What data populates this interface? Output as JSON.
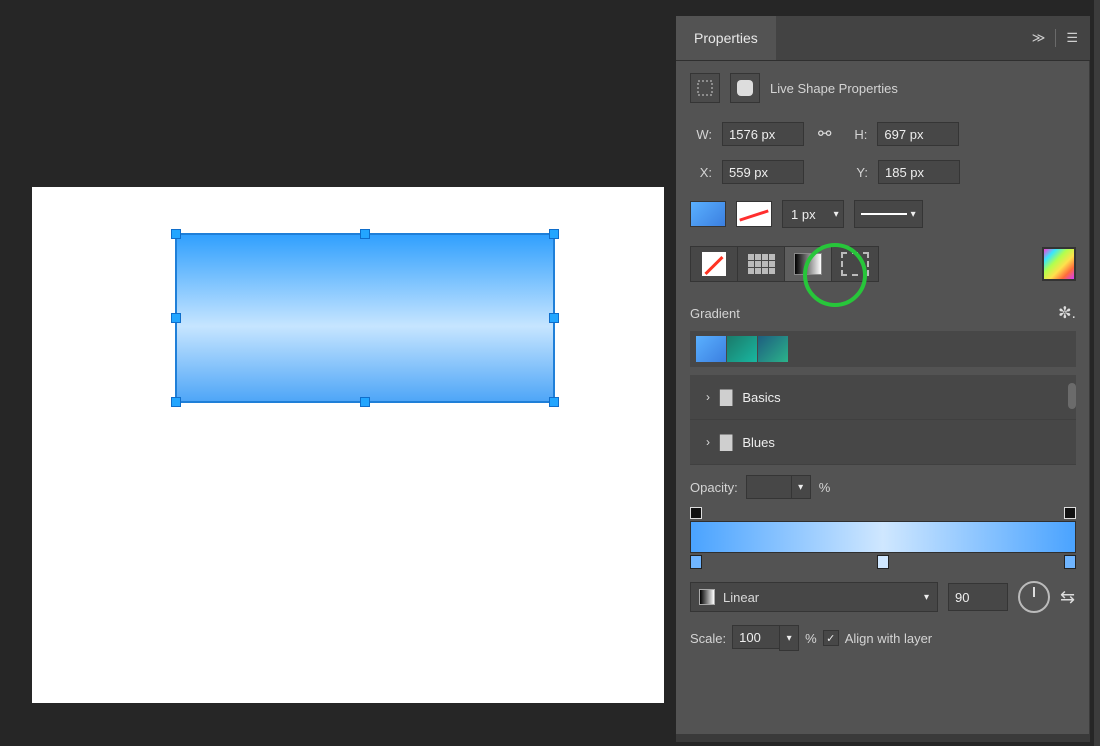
{
  "panel": {
    "title": "Properties",
    "section_title": "Live Shape Properties"
  },
  "dims": {
    "w_label": "W:",
    "w_value": "1576 px",
    "h_label": "H:",
    "h_value": "697 px",
    "x_label": "X:",
    "x_value": "559 px",
    "y_label": "Y:",
    "y_value": "185 px"
  },
  "stroke": {
    "width": "1 px"
  },
  "gradient": {
    "heading": "Gradient",
    "folders": [
      "Basics",
      "Blues"
    ],
    "opacity_label": "Opacity:",
    "opacity_pct": "%",
    "type": "Linear",
    "angle": "90",
    "scale_label": "Scale:",
    "scale_value": "100",
    "scale_pct": "%",
    "align_label": "Align with layer"
  }
}
